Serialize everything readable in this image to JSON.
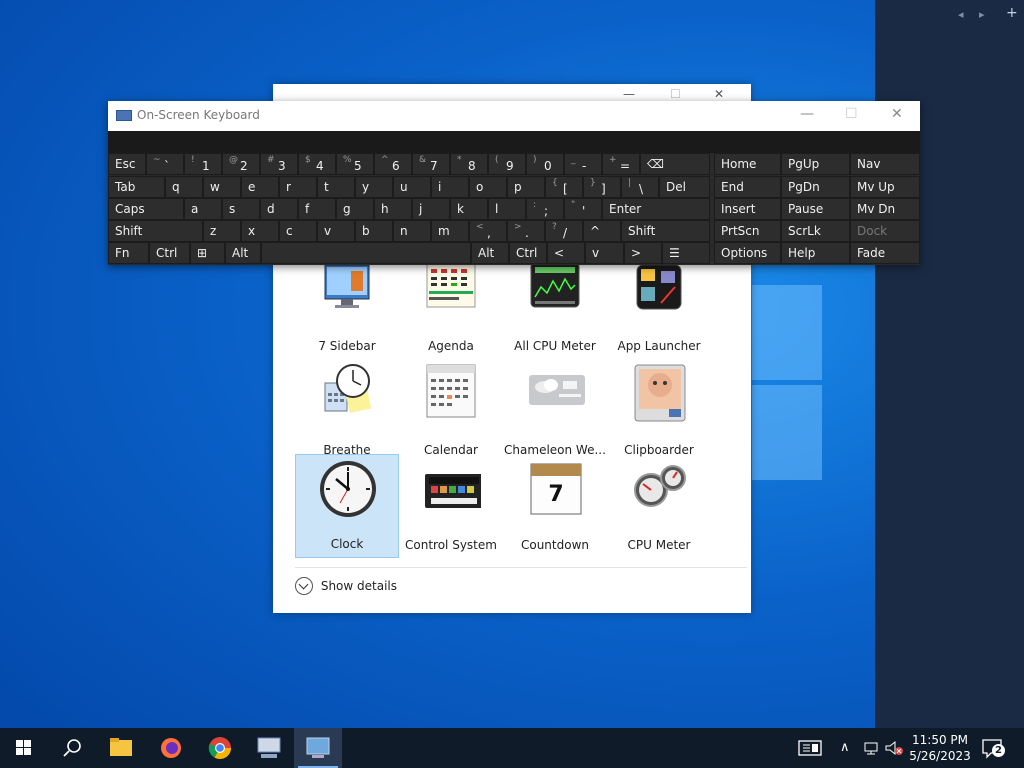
{
  "desktop": {
    "sidebar_controls": [
      "◂",
      "▸",
      "+"
    ]
  },
  "gadget_window": {
    "gadgets": [
      {
        "label": "7 Sidebar",
        "icon": "sidebar-monitor-icon"
      },
      {
        "label": "Agenda",
        "icon": "agenda-calendar-icon"
      },
      {
        "label": "All CPU Meter",
        "icon": "cpu-graph-icon"
      },
      {
        "label": "App Launcher",
        "icon": "app-launcher-icon"
      },
      {
        "label": "Breathe",
        "icon": "breathe-clock-icon"
      },
      {
        "label": "Calendar",
        "icon": "calendar-icon"
      },
      {
        "label": "Chameleon We...",
        "icon": "weather-icon"
      },
      {
        "label": "Clipboarder",
        "icon": "clipboard-photo-icon"
      },
      {
        "label": "Clock",
        "icon": "clock-icon",
        "selected": true
      },
      {
        "label": "Control System",
        "icon": "control-system-icon"
      },
      {
        "label": "Countdown",
        "icon": "countdown-calendar-icon"
      },
      {
        "label": "CPU Meter",
        "icon": "cpu-meter-icon"
      }
    ],
    "show_details_label": "Show details"
  },
  "osk": {
    "title": "On-Screen Keyboard",
    "rows": [
      [
        {
          "k": "Esc"
        },
        {
          "s": "~",
          "l": "`"
        },
        {
          "s": "!",
          "l": "1"
        },
        {
          "s": "@",
          "l": "2"
        },
        {
          "s": "#",
          "l": "3"
        },
        {
          "s": "$",
          "l": "4"
        },
        {
          "s": "%",
          "l": "5"
        },
        {
          "s": "^",
          "l": "6"
        },
        {
          "s": "&",
          "l": "7"
        },
        {
          "s": "*",
          "l": "8"
        },
        {
          "s": "(",
          "l": "9"
        },
        {
          "s": ")",
          "l": "0"
        },
        {
          "s": "_",
          "l": "-"
        },
        {
          "s": "+",
          "l": "="
        },
        {
          "k": "⌫"
        }
      ],
      [
        {
          "k": "Tab"
        },
        {
          "k": "q"
        },
        {
          "k": "w"
        },
        {
          "k": "e"
        },
        {
          "k": "r"
        },
        {
          "k": "t"
        },
        {
          "k": "y"
        },
        {
          "k": "u"
        },
        {
          "k": "i"
        },
        {
          "k": "o"
        },
        {
          "k": "p"
        },
        {
          "s": "{",
          "l": "["
        },
        {
          "s": "}",
          "l": "]"
        },
        {
          "s": "|",
          "l": "\\"
        },
        {
          "k": "Del"
        }
      ],
      [
        {
          "k": "Caps"
        },
        {
          "k": "a"
        },
        {
          "k": "s"
        },
        {
          "k": "d"
        },
        {
          "k": "f"
        },
        {
          "k": "g"
        },
        {
          "k": "h"
        },
        {
          "k": "j"
        },
        {
          "k": "k"
        },
        {
          "k": "l"
        },
        {
          "s": ":",
          "l": ";"
        },
        {
          "s": "\"",
          "l": "'"
        },
        {
          "k": "Enter"
        }
      ],
      [
        {
          "k": "Shift"
        },
        {
          "k": "z"
        },
        {
          "k": "x"
        },
        {
          "k": "c"
        },
        {
          "k": "v"
        },
        {
          "k": "b"
        },
        {
          "k": "n"
        },
        {
          "k": "m"
        },
        {
          "s": "<",
          "l": ","
        },
        {
          "s": ">",
          "l": "."
        },
        {
          "s": "?",
          "l": "/"
        },
        {
          "k": "^"
        },
        {
          "k": "Shift"
        }
      ],
      [
        {
          "k": "Fn"
        },
        {
          "k": "Ctrl"
        },
        {
          "k": "⊞"
        },
        {
          "k": "Alt"
        },
        {
          "k": ""
        },
        {
          "k": "Alt"
        },
        {
          "k": "Ctrl"
        },
        {
          "k": "<"
        },
        {
          "k": "v"
        },
        {
          "k": ">"
        },
        {
          "k": "☰"
        }
      ]
    ],
    "nav_keys": [
      [
        "Home",
        "PgUp",
        "Nav"
      ],
      [
        "End",
        "PgDn",
        "Mv Up"
      ],
      [
        "Insert",
        "Pause",
        "Mv Dn"
      ],
      [
        "PrtScn",
        "ScrLk",
        "Dock"
      ],
      [
        "Options",
        "Help",
        "Fade"
      ]
    ]
  },
  "taskbar": {
    "time": "11:50 PM",
    "date": "5/26/2023",
    "notification_count": "2",
    "apps": [
      "start-icon",
      "search-icon",
      "file-explorer-icon",
      "firefox-icon",
      "chrome-icon",
      "network-tool-icon",
      "gadgets-app-icon"
    ]
  }
}
